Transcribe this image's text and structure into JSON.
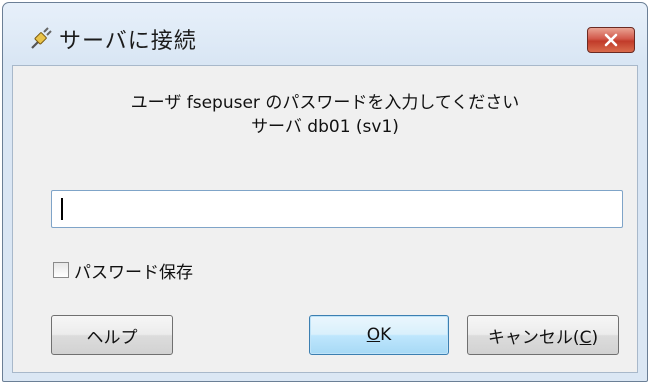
{
  "window": {
    "title": "サーバに接続",
    "close_label": "×"
  },
  "message": {
    "line1": "ユーザ fsepuser のパスワードを入力してください",
    "line2": "サーバ db01 (sv1)"
  },
  "password": {
    "value": ""
  },
  "save_password": {
    "label": "パスワード保存",
    "checked": false
  },
  "buttons": {
    "help": "ヘルプ",
    "ok_mnemonic": "O",
    "ok_rest": "K",
    "cancel_prefix": "キャンセル(",
    "cancel_mnemonic": "C",
    "cancel_suffix": ")"
  },
  "icons": {
    "title": "plug-connect-icon",
    "close": "close-icon"
  },
  "colors": {
    "close_button": "#c13b2a",
    "ok_button_border": "#3c7fb1"
  }
}
